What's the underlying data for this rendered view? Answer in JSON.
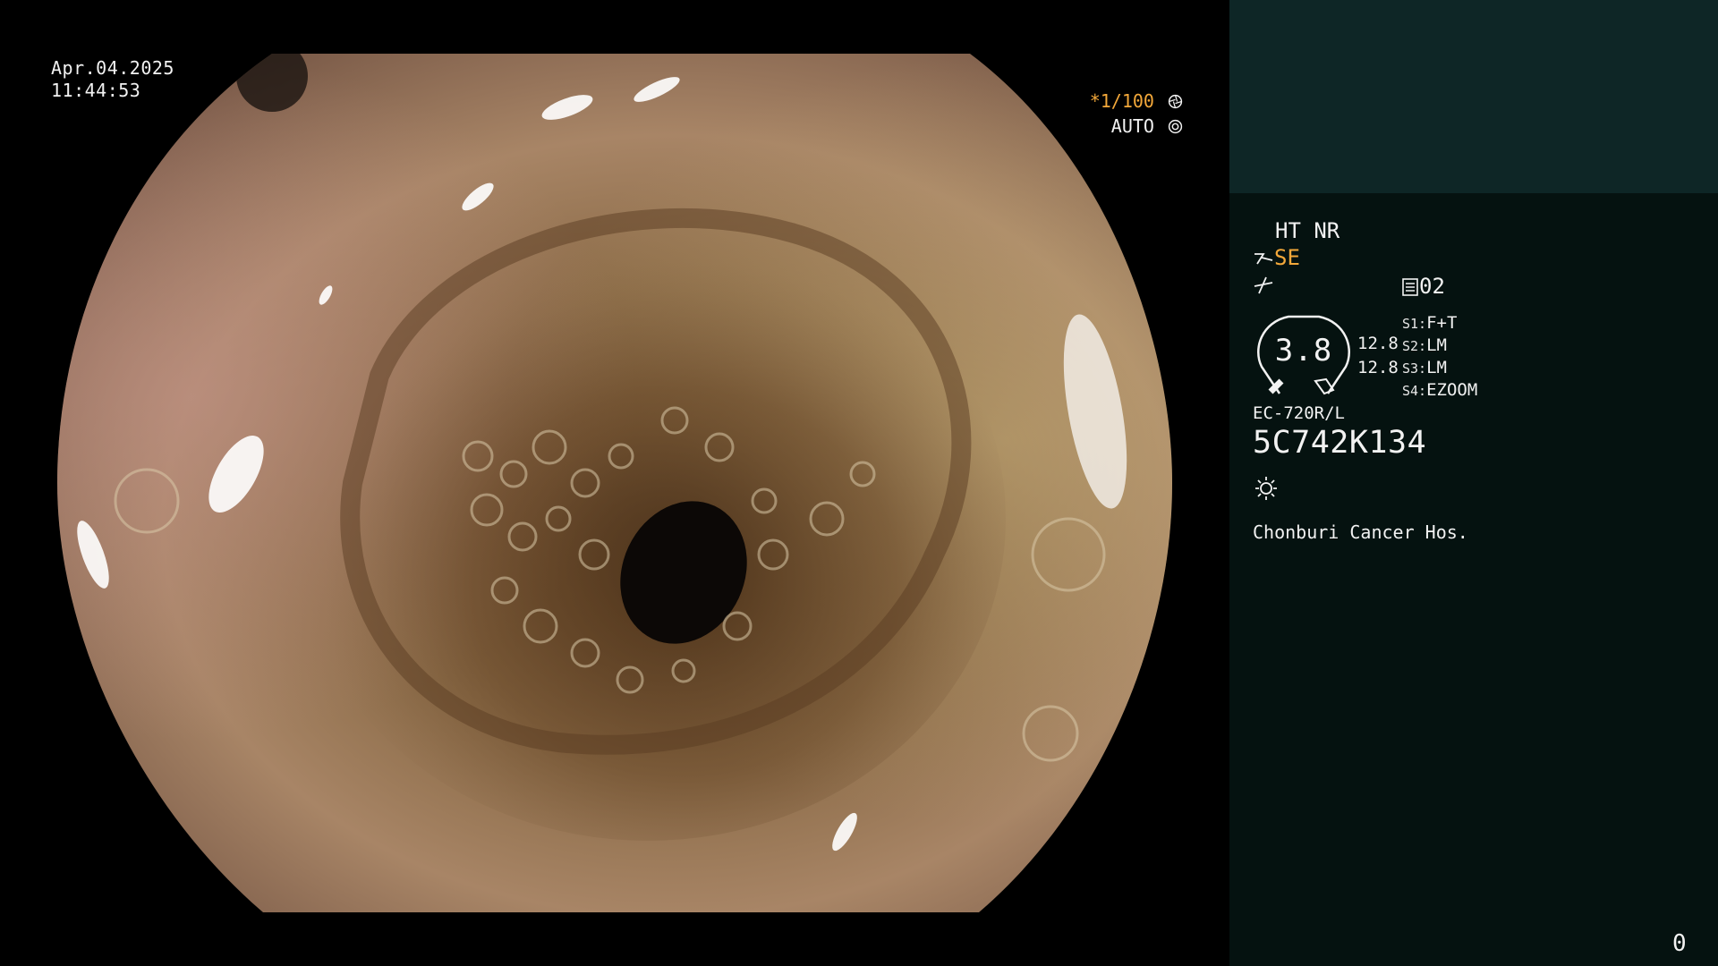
{
  "overlay": {
    "date": "Apr.04.2025",
    "time": "11:44:53",
    "shutter": "*1/100",
    "iris_mode": "AUTO"
  },
  "panel": {
    "enhance": "HT NR",
    "structure_mode": "SE",
    "record_count": "02",
    "zoom_value": "3.8",
    "value_1": "12.8",
    "value_2": "12.8",
    "switches": [
      {
        "key": "S1:",
        "value": "F+T"
      },
      {
        "key": "S2:",
        "value": "LM"
      },
      {
        "key": "S3:",
        "value": "LM"
      },
      {
        "key": "S4:",
        "value": "EZOOM"
      }
    ],
    "scope_model": "EC-720R/L",
    "scope_serial": "5C742K134",
    "hospital": "Chonburi Cancer Hos.",
    "frame_counter": "0"
  },
  "colors": {
    "accent_orange": "#f3a83a",
    "panel_top": "#0e2626",
    "panel_bottom": "#051210"
  },
  "icons": [
    "iris-icon",
    "auto-icon",
    "structure-icon",
    "curve-icon",
    "record-icon",
    "zoom-gauge",
    "light-icon"
  ]
}
